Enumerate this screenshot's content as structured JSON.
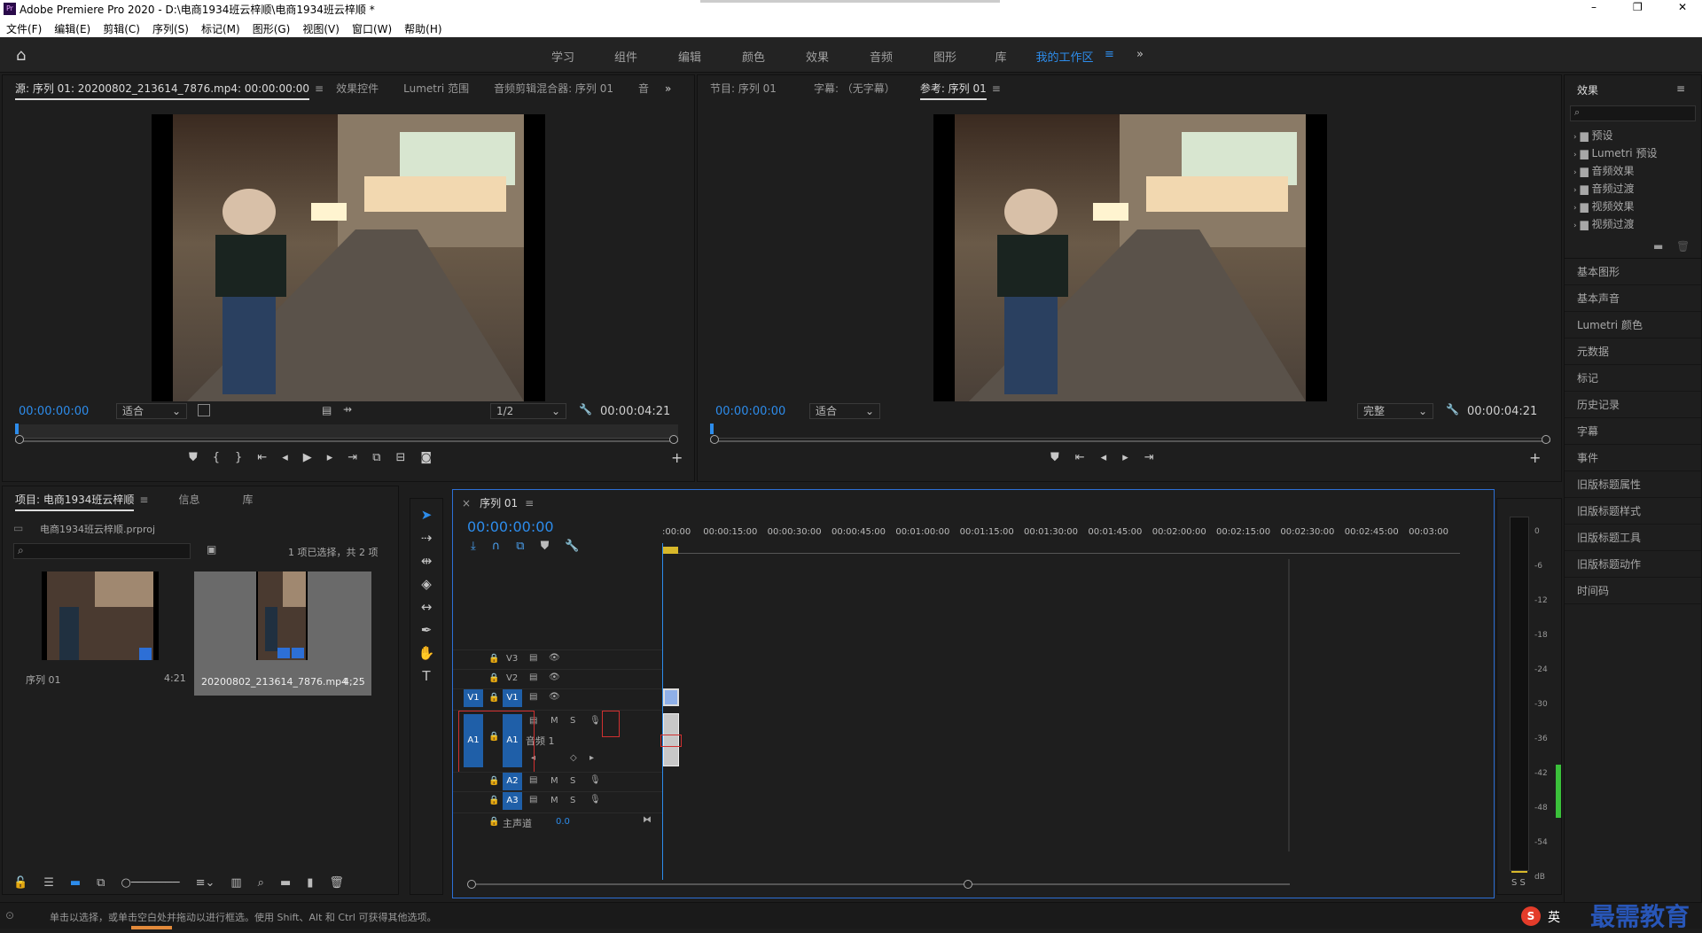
{
  "titlebar": {
    "app_title": "Adobe Premiere Pro 2020 - D:\\电商1934班云梓顺\\电商1934班云梓顺 *",
    "min": "–",
    "max": "❐",
    "close": "✕"
  },
  "menu": [
    "文件(F)",
    "编辑(E)",
    "剪辑(C)",
    "序列(S)",
    "标记(M)",
    "图形(G)",
    "视图(V)",
    "窗口(W)",
    "帮助(H)"
  ],
  "workspaces": [
    "学习",
    "组件",
    "编辑",
    "颜色",
    "效果",
    "音频",
    "图形",
    "库"
  ],
  "active_workspace": "我的工作区",
  "source_panel": {
    "tabs": [
      "源: 序列 01: 20200802_213614_7876.mp4: 00:00:00:00",
      "效果控件",
      "Lumetri 范围",
      "音频剪辑混合器: 序列 01",
      "音"
    ],
    "timecode": "00:00:00:00",
    "fit": "适合",
    "resolution": "1/2",
    "duration": "00:00:04:21"
  },
  "program_panel": {
    "tabs": [
      "节目: 序列 01",
      "字幕: （无字幕）",
      "参考: 序列 01"
    ],
    "timecode": "00:00:00:00",
    "fit": "适合",
    "quality": "完整",
    "duration": "00:00:04:21"
  },
  "project_panel": {
    "tabs": [
      "项目: 电商1934班云梓顺",
      "信息",
      "库"
    ],
    "file": "电商1934班云梓顺.prproj",
    "selection": "1 项已选择，共 2 项",
    "items": [
      {
        "name": "序列 01",
        "duration": "4:21"
      },
      {
        "name": "20200802_213614_7876.mp4",
        "duration": "4;25"
      }
    ]
  },
  "timeline": {
    "tab": "序列 01",
    "timecode": "00:00:00:00",
    "ruler": [
      ":00:00",
      "00:00:15:00",
      "00:00:30:00",
      "00:00:45:00",
      "00:01:00:00",
      "00:01:15:00",
      "00:01:30:00",
      "00:01:45:00",
      "00:02:00:00",
      "00:02:15:00",
      "00:02:30:00",
      "00:02:45:00",
      "00:03:00"
    ],
    "tracks": {
      "v3": "V3",
      "v2": "V2",
      "v1": "V1",
      "src_v1": "V1",
      "a1": "A1",
      "src_a1": "A1",
      "a2": "A2",
      "a3": "A3",
      "m": "M",
      "s": "S",
      "audio1": "音频 1",
      "master": "主声道",
      "master_val": "0.0"
    }
  },
  "meter": {
    "scale": [
      "0",
      "-6",
      "-12",
      "-18",
      "-24",
      "-30",
      "-36",
      "-42",
      "-48",
      "-54",
      "dB"
    ],
    "solo": "S S"
  },
  "effects": {
    "title": "效果",
    "tree": [
      "预设",
      "Lumetri 预设",
      "音频效果",
      "音频过渡",
      "视频效果",
      "视频过渡"
    ],
    "panels": [
      "基本图形",
      "基本声音",
      "Lumetri 颜色",
      "元数据",
      "标记",
      "历史记录",
      "字幕",
      "事件",
      "旧版标题属性",
      "旧版标题样式",
      "旧版标题工具",
      "旧版标题动作",
      "时间码"
    ]
  },
  "status": {
    "text": "单击以选择，或单击空白处并拖动以进行框选。使用 Shift、Alt 和 Ctrl 可获得其他选项。"
  },
  "watermark": {
    "ime": "英",
    "brand": "最需教育"
  }
}
